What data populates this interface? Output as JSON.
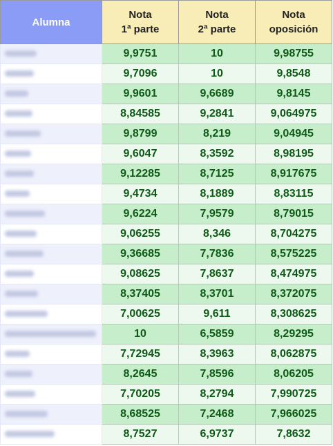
{
  "table": {
    "headers": {
      "student": "Alumna",
      "part1": [
        "Nota",
        "1ª parte"
      ],
      "part2": [
        "Nota",
        "2ª parte"
      ],
      "final": [
        "Nota",
        "oposición"
      ]
    },
    "rows": [
      {
        "part1": "9,9751",
        "part2": "10",
        "final": "9,98755"
      },
      {
        "part1": "9,7096",
        "part2": "10",
        "final": "9,8548"
      },
      {
        "part1": "9,9601",
        "part2": "9,6689",
        "final": "9,8145"
      },
      {
        "part1": "8,84585",
        "part2": "9,2841",
        "final": "9,064975"
      },
      {
        "part1": "9,8799",
        "part2": "8,219",
        "final": "9,04945"
      },
      {
        "part1": "9,6047",
        "part2": "8,3592",
        "final": "8,98195"
      },
      {
        "part1": "9,12285",
        "part2": "8,7125",
        "final": "8,917675"
      },
      {
        "part1": "9,4734",
        "part2": "8,1889",
        "final": "8,83115"
      },
      {
        "part1": "9,6224",
        "part2": "7,9579",
        "final": "8,79015"
      },
      {
        "part1": "9,06255",
        "part2": "8,346",
        "final": "8,704275"
      },
      {
        "part1": "9,36685",
        "part2": "7,7836",
        "final": "8,575225"
      },
      {
        "part1": "9,08625",
        "part2": "7,8637",
        "final": "8,474975"
      },
      {
        "part1": "8,37405",
        "part2": "8,3701",
        "final": "8,372075"
      },
      {
        "part1": "7,00625",
        "part2": "9,611",
        "final": "8,308625"
      },
      {
        "part1": "10",
        "part2": "6,5859",
        "final": "8,29295"
      },
      {
        "part1": "7,72945",
        "part2": "8,3963",
        "final": "8,062875"
      },
      {
        "part1": "8,2645",
        "part2": "7,8596",
        "final": "8,06205"
      },
      {
        "part1": "7,70205",
        "part2": "8,2794",
        "final": "7,990725"
      },
      {
        "part1": "8,68525",
        "part2": "7,2468",
        "final": "7,966025"
      },
      {
        "part1": "8,7527",
        "part2": "6,9737",
        "final": "7,8632"
      }
    ]
  }
}
